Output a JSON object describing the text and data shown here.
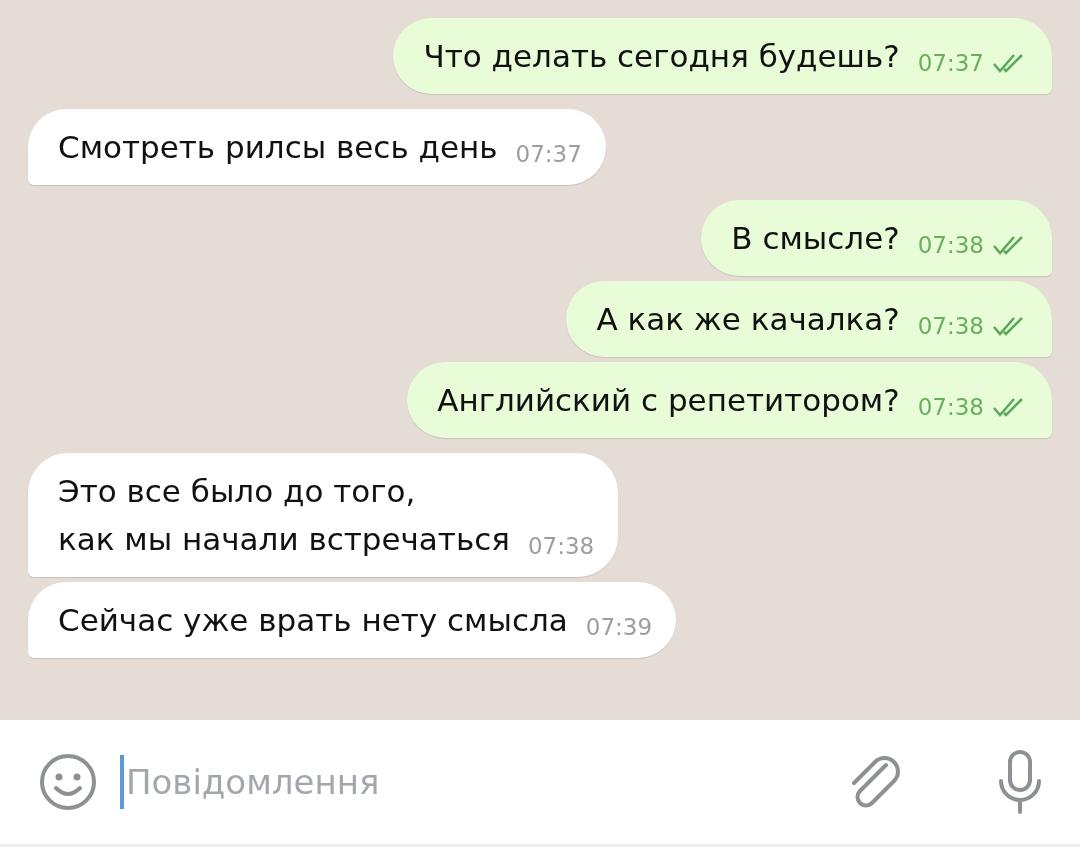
{
  "messages": [
    {
      "kind": "outgoing",
      "lines": [
        "Что делать сегодня будешь?"
      ],
      "time": "07:37",
      "read": true
    },
    {
      "kind": "incoming",
      "lines": [
        "Смотреть рилсы весь день"
      ],
      "time": "07:37"
    },
    {
      "kind": "outgoing",
      "lines": [
        "В смысле?"
      ],
      "time": "07:38",
      "read": true
    },
    {
      "kind": "outgoing",
      "lines": [
        "А как же качалка?"
      ],
      "time": "07:38",
      "read": true
    },
    {
      "kind": "outgoing",
      "lines": [
        "Английский с репетитором?"
      ],
      "time": "07:38",
      "read": true
    },
    {
      "kind": "incoming",
      "lines": [
        "Это все было до того,",
        "как мы начали встречаться"
      ],
      "time": "07:38"
    },
    {
      "kind": "incoming",
      "lines": [
        "Сейчас уже врать нету смысла"
      ],
      "time": "07:39"
    }
  ],
  "composer": {
    "placeholder": "Повідомлення"
  }
}
